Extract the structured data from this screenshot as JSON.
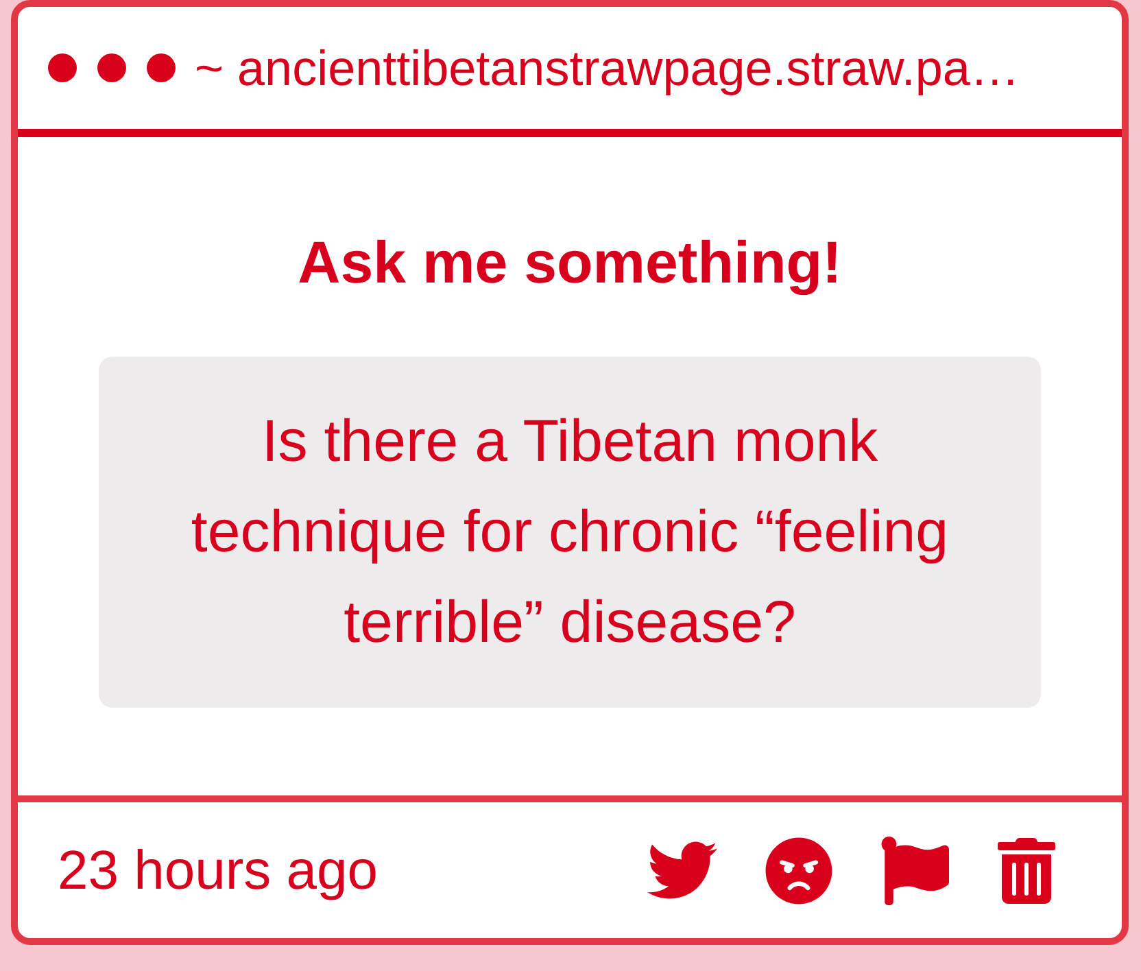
{
  "window": {
    "title": "~ ancienttibetanstrawpage.straw.pa…"
  },
  "post": {
    "heading": "Ask me something!",
    "question": "Is there a Tibetan monk technique for chronic “feeling terrible” disease?"
  },
  "footer": {
    "time": "23 hours ago"
  }
}
